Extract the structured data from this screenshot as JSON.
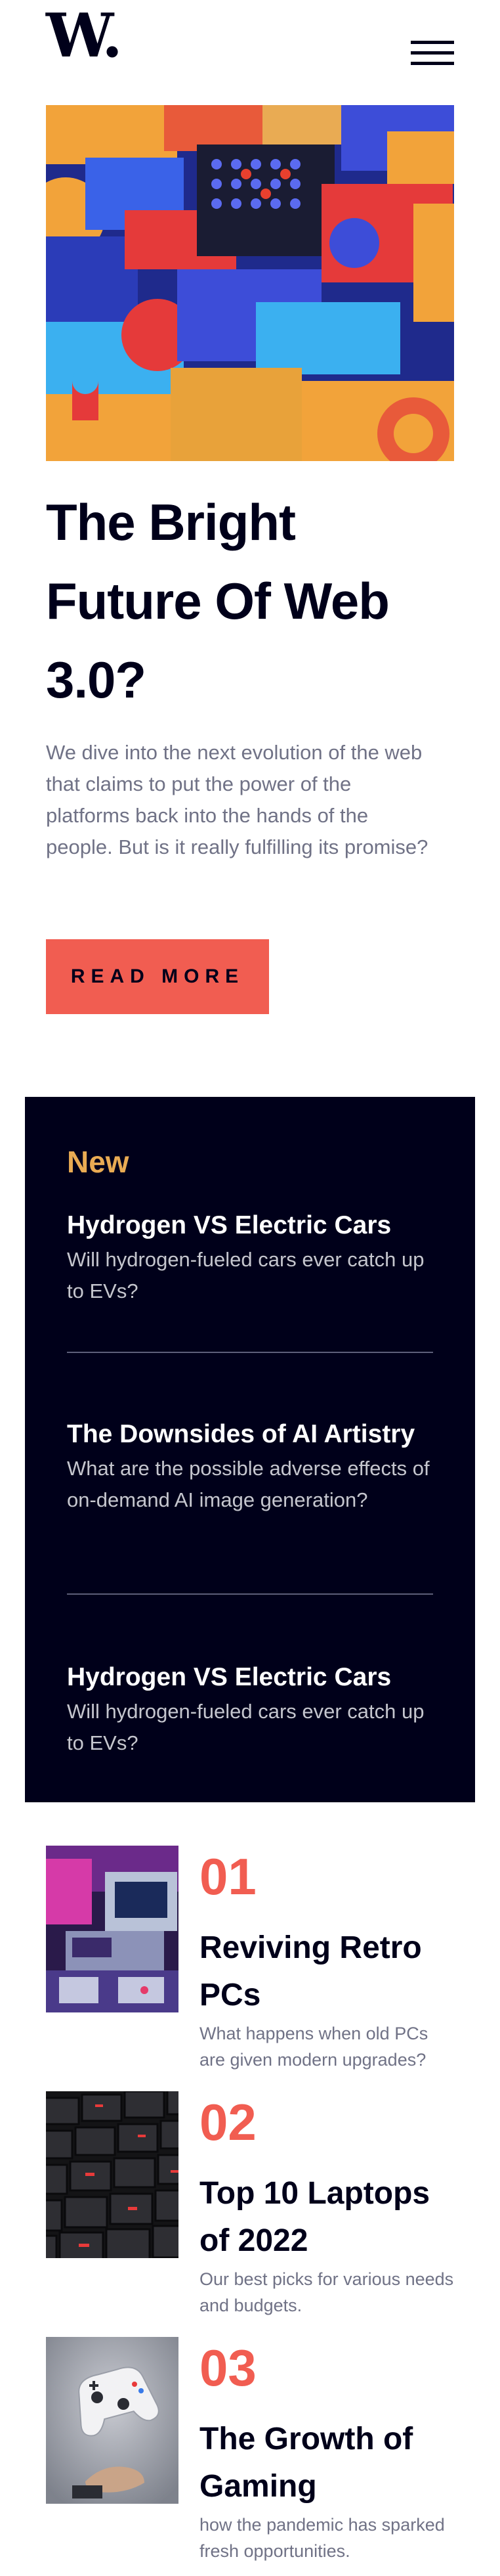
{
  "header": {
    "logo": "W.",
    "menu_icon": "hamburger-menu-icon"
  },
  "hero": {
    "image": "abstract-3d-blocks-image",
    "title": "The Bright Future Of Web 3.0?",
    "description": "We dive into the next evolution of the web that claims to put the power of the platforms back into the hands of the people. But is it really fulfilling its promise?",
    "button_label": "READ MORE"
  },
  "new_section": {
    "heading": "New",
    "items": [
      {
        "title": "Hydrogen VS Electric Cars",
        "description": "Will hydrogen-fueled cars ever catch up to EVs?"
      },
      {
        "title": "The Downsides of AI Artistry",
        "description": "What are the possible adverse effects of on-demand AI image generation?"
      },
      {
        "title": "Hydrogen VS Electric Cars",
        "description": "Will hydrogen-fueled cars ever catch up to EVs?"
      }
    ]
  },
  "articles": [
    {
      "number": "01",
      "title": "Reviving Retro PCs",
      "description": "What happens when old PCs are given modern upgrades?",
      "image": "retro-pc-image"
    },
    {
      "number": "02",
      "title": "Top 10 Laptops of 2022",
      "description": "Our best picks for various needs and budgets.",
      "image": "laptop-keyboard-image"
    },
    {
      "number": "03",
      "title": "The Growth of Gaming",
      "description": "how the pandemic has sparked fresh opportunities.",
      "image": "game-controller-image"
    }
  ],
  "colors": {
    "accent_red": "#f15d51",
    "accent_orange": "#e9ab53",
    "dark_navy": "#00001a",
    "body_gray": "#707286"
  }
}
